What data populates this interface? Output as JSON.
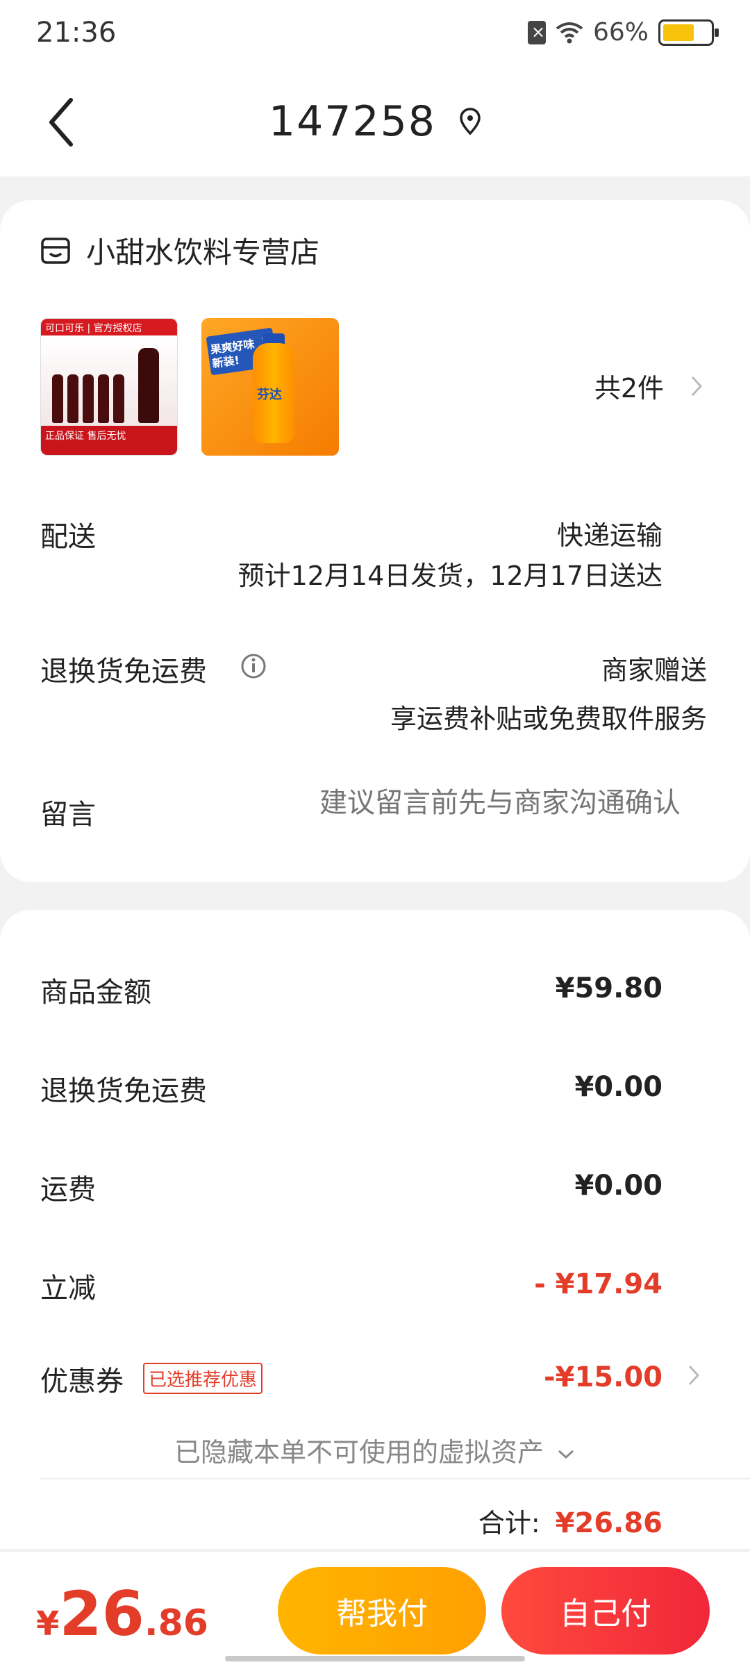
{
  "status": {
    "time": "21:36",
    "battery": "66%",
    "battery_level": 0.66
  },
  "header": {
    "title": "147258"
  },
  "store": {
    "name": "小甜水饮料专营店"
  },
  "products": {
    "count_text": "共2件",
    "items": [
      {
        "brand": "可口可乐",
        "tag": "官方授权店",
        "footer": "正品保证 售后无忧"
      },
      {
        "tag": "果爽好味 上新装!",
        "brand": "芬达"
      }
    ]
  },
  "delivery": {
    "label": "配送",
    "method": "快递运输",
    "eta": "预计12月14日发货，12月17日送达"
  },
  "return_shipping": {
    "label": "退换货免运费",
    "value": "商家赠送",
    "desc": "享运费补贴或免费取件服务"
  },
  "message": {
    "label": "留言",
    "placeholder": "建议留言前先与商家沟通确认"
  },
  "fees": {
    "goods_label": "商品金额",
    "goods_value": "¥59.80",
    "return_label": "退换货免运费",
    "return_value": "¥0.00",
    "shipping_label": "运费",
    "shipping_value": "¥0.00",
    "discount_label": "立减",
    "discount_value": "- ¥17.94",
    "coupon_label": "优惠券",
    "coupon_badge": "已选推荐优惠",
    "coupon_value": "-¥15.00"
  },
  "hidden_assets": "已隐藏本单不可使用的虚拟资产",
  "total": {
    "label": "合计:",
    "value": "¥26.86"
  },
  "bottom": {
    "currency": "¥",
    "amount_int": "26",
    "amount_dec": ".86",
    "help_pay": "帮我付",
    "self_pay": "自己付"
  },
  "colors": {
    "accent_red": "#e33d2a",
    "help_btn": "#ffa000",
    "self_btn": "#f0273a"
  }
}
